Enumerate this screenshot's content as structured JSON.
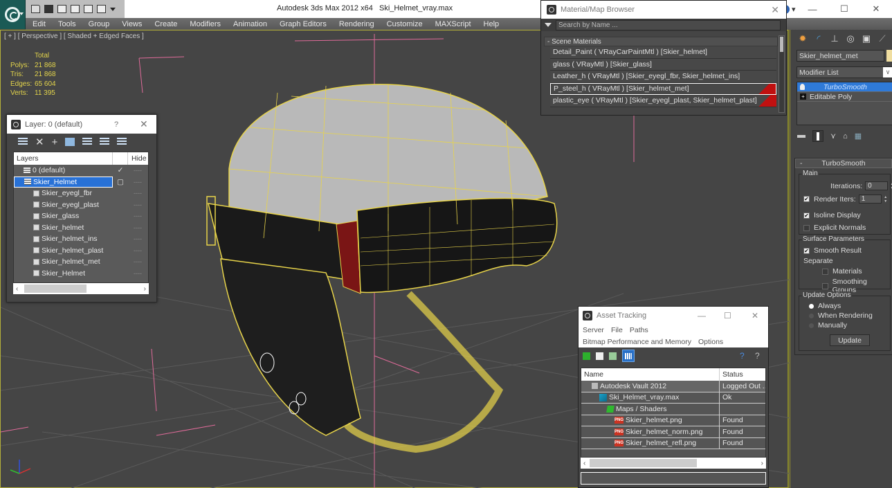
{
  "titlebar": {
    "app_title": "Autodesk 3ds Max  2012 x64",
    "file_title": "Ski_Helmet_vray.max",
    "minimize": "—",
    "maximize": "☐",
    "close": "✕",
    "quick_access_icons": [
      "open-icon",
      "save-icon",
      "new-icon",
      "project-icon",
      "undo-icon",
      "redo-icon"
    ]
  },
  "menubar": {
    "items": [
      "Edit",
      "Tools",
      "Group",
      "Views",
      "Create",
      "Modifiers",
      "Animation",
      "Graph Editors",
      "Rendering",
      "Customize",
      "MAXScript",
      "Help"
    ]
  },
  "viewport": {
    "label": "[ + ] [ Perspective ] [ Shaded + Edged Faces ]",
    "stats": {
      "header": "Total",
      "rows": [
        {
          "label": "Polys:",
          "value": "21 868"
        },
        {
          "label": "Tris:",
          "value": "21 868"
        },
        {
          "label": "Edges:",
          "value": "65 604"
        },
        {
          "label": "Verts:",
          "value": "11 395"
        }
      ]
    },
    "colors": {
      "wire": "#e8d44a",
      "grid": "#5c5c5c",
      "axis": "#e06b9a"
    }
  },
  "layer_dialog": {
    "title": "Layer: 0 (default)",
    "help": "?",
    "close": "✕",
    "columns": {
      "layers": "Layers",
      "hide": "Hide"
    },
    "rows": [
      {
        "name": "0 (default)",
        "type": "layer",
        "indent": 1,
        "check": "✓",
        "hide": "----"
      },
      {
        "name": "Skier_Helmet",
        "type": "layer",
        "indent": 1,
        "check": "▢",
        "hide": "----",
        "selected": true
      },
      {
        "name": "Skier_eyegl_fbr",
        "type": "object",
        "indent": 2,
        "hide": "----"
      },
      {
        "name": "Skier_eyegl_plast",
        "type": "object",
        "indent": 2,
        "hide": "----"
      },
      {
        "name": "Skier_glass",
        "type": "object",
        "indent": 2,
        "hide": "----"
      },
      {
        "name": "Skier_helmet",
        "type": "object",
        "indent": 2,
        "hide": "----"
      },
      {
        "name": "Skier_helmet_ins",
        "type": "object",
        "indent": 2,
        "hide": "----"
      },
      {
        "name": "Skier_helmet_plast",
        "type": "object",
        "indent": 2,
        "hide": "----"
      },
      {
        "name": "Skier_helmet_met",
        "type": "object",
        "indent": 2,
        "hide": "----"
      },
      {
        "name": "Skier_Helmet",
        "type": "object",
        "indent": 2,
        "hide": "----"
      }
    ]
  },
  "material_browser": {
    "title": "Material/Map Browser",
    "close": "✕",
    "search_placeholder": "Search by Name ...",
    "section": "- Scene Materials",
    "items": [
      {
        "label": "Detail_Paint  ( VRayCarPaintMtl )  [Skier_helmet]",
        "red": false,
        "selected": false
      },
      {
        "label": "glass  ( VRayMtl )  [Skier_glass]",
        "red": false,
        "selected": false
      },
      {
        "label": "Leather_h  ( VRayMtl )  [Skier_eyegl_fbr, Skier_helmet_ins]",
        "red": false,
        "selected": false
      },
      {
        "label": "P_steel_h  ( VRayMtl )  [Skier_helmet_met]",
        "red": true,
        "selected": true
      },
      {
        "label": "plastic_eye  ( VRayMtl )  [Skier_eyegl_plast, Skier_helmet_plast]",
        "red": true,
        "selected": false
      }
    ]
  },
  "command_panel": {
    "object_name": "Skier_helmet_met",
    "object_color": "#f0dea0",
    "modifier_list": "Modifier List",
    "stack": [
      {
        "label": "TurboSmooth",
        "selected": true
      },
      {
        "label": "Editable Poly",
        "selected": false
      }
    ],
    "rollout": {
      "title": "TurboSmooth",
      "main_group": "Main",
      "iterations_label": "Iterations:",
      "iterations": "0",
      "render_iters_label": "Render Iters:",
      "render_iters": "1",
      "render_iters_checked": true,
      "isoline_display": {
        "label": "Isoline Display",
        "checked": true
      },
      "explicit_normals": {
        "label": "Explicit Normals",
        "checked": false
      },
      "surface_group": "Surface Parameters",
      "smooth_result": {
        "label": "Smooth Result",
        "checked": true
      },
      "separate_label": "Separate",
      "materials": {
        "label": "Materials",
        "checked": false
      },
      "smoothing_groups": {
        "label": "Smoothing Groups",
        "checked": false
      },
      "update_group": "Update Options",
      "update_options": [
        {
          "label": "Always",
          "selected": true
        },
        {
          "label": "When Rendering",
          "selected": false
        },
        {
          "label": "Manually",
          "selected": false
        }
      ],
      "update_button": "Update"
    }
  },
  "asset_tracking": {
    "title": "Asset Tracking",
    "minimize": "—",
    "maximize": "☐",
    "close": "✕",
    "menu_row1": [
      "Server",
      "File",
      "Paths"
    ],
    "menu_row2": [
      "Bitmap Performance and Memory",
      "Options"
    ],
    "columns": {
      "name": "Name",
      "status": "Status"
    },
    "rows": [
      {
        "name": "Autodesk Vault 2012",
        "status": "Logged Out ...",
        "icon": "vault-icon",
        "indent": 2
      },
      {
        "name": "Ski_Helmet_vray.max",
        "status": "Ok",
        "icon": "max-file-icon",
        "indent": 3
      },
      {
        "name": "Maps / Shaders",
        "status": "",
        "icon": "maps-icon",
        "indent": 4
      },
      {
        "name": "Skier_helmet.png",
        "status": "Found",
        "icon": "png-icon",
        "indent": 5
      },
      {
        "name": "Skier_helmet_norm.png",
        "status": "Found",
        "icon": "png-icon",
        "indent": 5
      },
      {
        "name": "Skier_helmet_refl.png",
        "status": "Found",
        "icon": "png-icon",
        "indent": 5
      }
    ]
  }
}
